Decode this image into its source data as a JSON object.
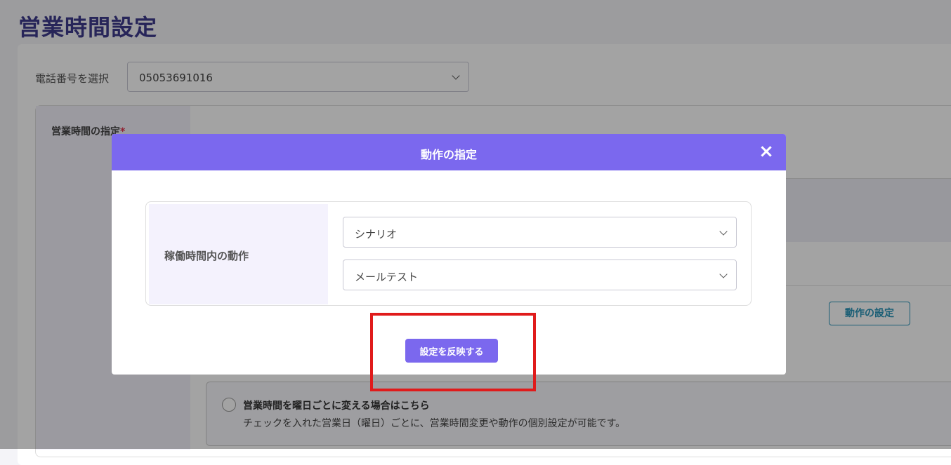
{
  "page": {
    "title": "営業時間設定"
  },
  "phone": {
    "label": "電話番号を選択",
    "selected": "05053691016"
  },
  "hours": {
    "label": "営業時間の指定",
    "required_mark": "*"
  },
  "background": {
    "action_setting_button": "動作の設定",
    "weekday_option": {
      "title": "営業時間を曜日ごとに変える場合はこちら",
      "description": "チェックを入れた営業日（曜日）ごとに、営業時間変更や動作の個別設定が可能です。"
    }
  },
  "modal": {
    "title": "動作の指定",
    "close_symbol": "×",
    "row_label": "稼働時間内の動作",
    "select1": "シナリオ",
    "select2": "メールテスト",
    "apply_button": "設定を反映する"
  },
  "colors": {
    "accent": "#7b68ee",
    "highlight": "#e01b1b",
    "title": "#3d3a8c",
    "link": "#2a93b8"
  }
}
